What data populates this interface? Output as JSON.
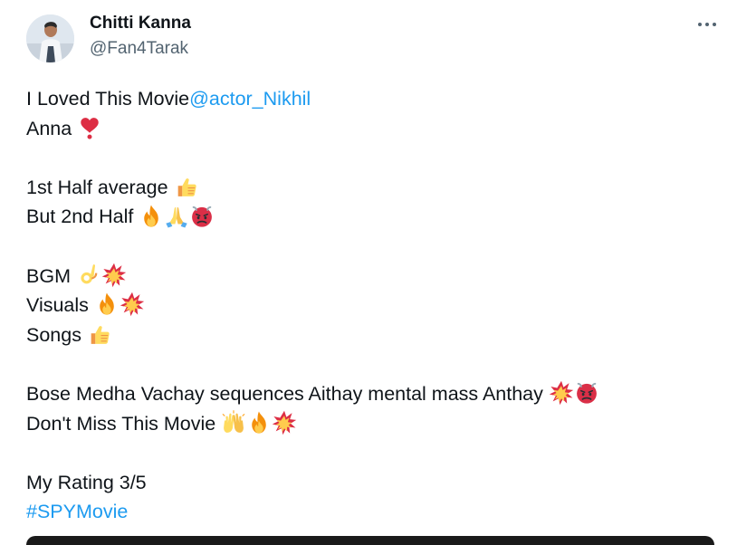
{
  "author": {
    "display_name": "Chitti Kanna",
    "handle": "@Fan4Tarak"
  },
  "menu": {
    "icon": "more-horizontal-icon"
  },
  "tweet": {
    "line1_text": "I Loved This Movie ",
    "line1_mention": "@actor_Nikhil",
    "line2_text": "Anna",
    "line3_text": "1st Half average",
    "line4_text": "But 2nd Half",
    "line5_text": "BGM",
    "line6_text": "Visuals",
    "line7_text": "Songs",
    "line8_text": "Bose Medha Vachay sequences Aithay mental mass Anthay",
    "line9_text": "Don't Miss This Movie",
    "line10_text": "My Rating 3/5",
    "hashtag": "#SPYMovie",
    "emoji": {
      "line2": [
        "heart-exclamation-icon"
      ],
      "line3": [
        "thumbs-up-icon"
      ],
      "line4": [
        "fire-icon",
        "folded-hands-icon",
        "angry-face-icon"
      ],
      "line5": [
        "ok-hand-icon",
        "collision-icon"
      ],
      "line6": [
        "fire-icon",
        "collision-icon"
      ],
      "line7": [
        "thumbs-up-icon"
      ],
      "line8": [
        "collision-icon",
        "angry-face-icon"
      ],
      "line9": [
        "raising-hands-icon",
        "fire-icon",
        "collision-icon"
      ]
    }
  },
  "colors": {
    "text": "#0f1419",
    "secondary": "#536471",
    "link": "#1d9bf0"
  }
}
